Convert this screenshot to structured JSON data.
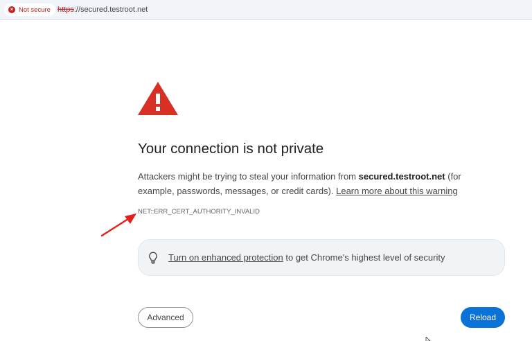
{
  "address_bar": {
    "security_chip": "Not secure",
    "url_scheme": "https",
    "url_rest": "://secured.testroot.net"
  },
  "interstitial": {
    "title": "Your connection is not private",
    "desc_pre": "Attackers might be trying to steal your information from ",
    "domain": "secured.testroot.net",
    "desc_post": " (for example, passwords, messages, or credit cards). ",
    "learn_more": "Learn more about this warning",
    "error_code": "NET::ERR_CERT_AUTHORITY_INVALID",
    "protection_link": "Turn on enhanced protection",
    "protection_rest": " to get Chrome's highest level of security"
  },
  "buttons": {
    "advanced": "Advanced",
    "reload": "Reload"
  },
  "colors": {
    "warning_red": "#d93025",
    "reload_blue": "#0b72d8",
    "annotation_arrow": "#e3201b"
  },
  "icons": [
    "error-x-icon",
    "warning-triangle-icon",
    "lightbulb-icon",
    "annotation-arrow",
    "mouse-cursor-icon"
  ]
}
